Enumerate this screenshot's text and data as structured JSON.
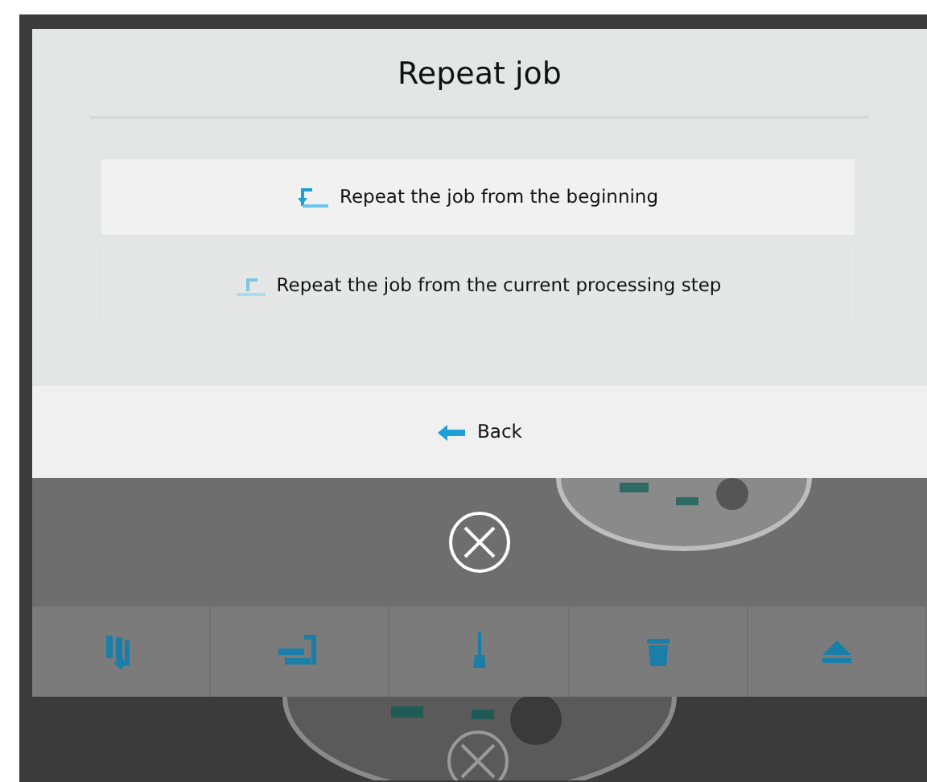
{
  "dialog": {
    "title": "Repeat job",
    "options": [
      {
        "label": "Repeat the job from the beginning",
        "selected": true
      },
      {
        "label": "Repeat the job from the current processing step",
        "selected": false
      }
    ],
    "back_button": {
      "label": "Back"
    }
  }
}
